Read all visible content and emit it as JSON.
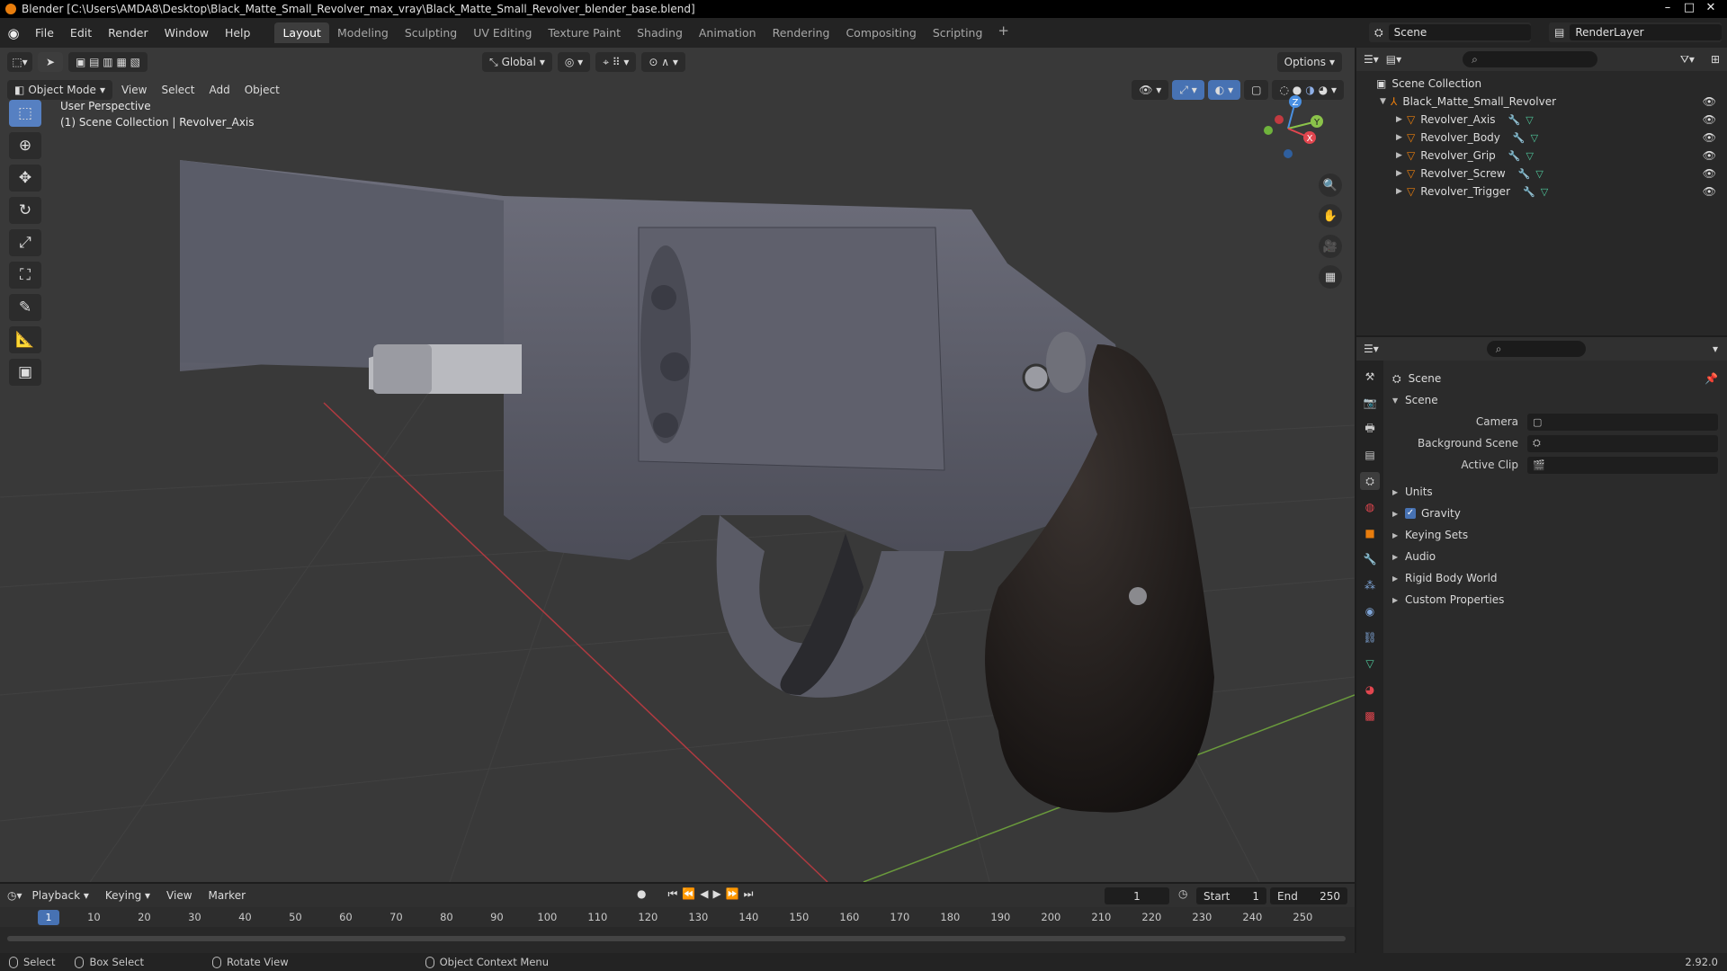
{
  "window": {
    "title": "Blender [C:\\Users\\AMDA8\\Desktop\\Black_Matte_Small_Revolver_max_vray\\Black_Matte_Small_Revolver_blender_base.blend]",
    "controls": [
      "–",
      "□",
      "✕"
    ]
  },
  "menu": {
    "items": [
      "File",
      "Edit",
      "Render",
      "Window",
      "Help"
    ],
    "workspaces": [
      "Layout",
      "Modeling",
      "Sculpting",
      "UV Editing",
      "Texture Paint",
      "Shading",
      "Animation",
      "Rendering",
      "Compositing",
      "Scripting"
    ],
    "add_workspace": "+",
    "scene": "Scene",
    "render_layer": "RenderLayer"
  },
  "viewport": {
    "mode": "Object Mode",
    "menus": [
      "View",
      "Select",
      "Add",
      "Object"
    ],
    "transform_orientation": "Global",
    "options_label": "Options",
    "perspective": "User Perspective",
    "collection_path": "(1) Scene Collection | Revolver_Axis",
    "gizmo_axes": [
      "Z",
      "Y",
      "X"
    ],
    "tool_icons": [
      "select-box-icon",
      "cursor-icon",
      "move-icon",
      "rotate-icon",
      "scale-icon",
      "transform-icon",
      "annotate-icon",
      "measure-icon",
      "add-cube-icon"
    ],
    "nav_icons": [
      "zoom-icon",
      "pan-hand-icon",
      "camera-view-icon",
      "ortho-grid-icon"
    ]
  },
  "outliner": {
    "root": "Scene Collection",
    "collection": "Black_Matte_Small_Revolver",
    "objects": [
      "Revolver_Axis",
      "Revolver_Body",
      "Revolver_Grip",
      "Revolver_Screw",
      "Revolver_Trigger"
    ]
  },
  "properties": {
    "header": "Scene",
    "panel": "Scene",
    "fields": [
      {
        "label": "Camera",
        "value": ""
      },
      {
        "label": "Background Scene",
        "value": ""
      },
      {
        "label": "Active Clip",
        "value": ""
      }
    ],
    "subpanels": [
      "Units",
      "Gravity",
      "Keying Sets",
      "Audio",
      "Rigid Body World",
      "Custom Properties"
    ],
    "gravity_checked": true,
    "tab_icons": [
      "tool-icon",
      "render-icon",
      "output-icon",
      "view-layer-icon",
      "scene-icon",
      "world-icon",
      "object-icon",
      "modifier-icon",
      "particles-icon",
      "physics-icon",
      "constraints-icon",
      "data-icon",
      "material-icon",
      "texture-icon"
    ]
  },
  "timeline": {
    "menus": [
      "Playback",
      "Keying",
      "View",
      "Marker"
    ],
    "current_frame": "1",
    "start_label": "Start",
    "start": "1",
    "end_label": "End",
    "end": "250",
    "ruler": [
      "1",
      "10",
      "20",
      "30",
      "40",
      "50",
      "60",
      "70",
      "80",
      "90",
      "100",
      "110",
      "120",
      "130",
      "140",
      "150",
      "160",
      "170",
      "180",
      "190",
      "200",
      "210",
      "220",
      "230",
      "240",
      "250"
    ]
  },
  "status": {
    "select": "Select",
    "box_select": "Box Select",
    "rotate_view": "Rotate View",
    "context_menu": "Object Context Menu",
    "version": "2.92.0"
  },
  "colors": {
    "accent": "#4772b3",
    "x_axis": "#e2464f",
    "y_axis": "#8bc34a",
    "z_axis": "#4a90e2",
    "object_orange": "#e87d0d"
  }
}
